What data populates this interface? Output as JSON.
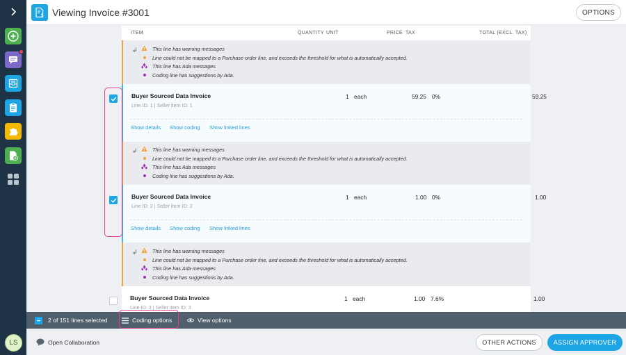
{
  "header": {
    "title": "Viewing Invoice #3001",
    "options_label": "OPTIONS"
  },
  "sidebar": {
    "avatar_initials": "LS",
    "items": [
      {
        "icon": "add-icon",
        "color": "#4caf50"
      },
      {
        "icon": "messages-icon",
        "color": "#7b68c9",
        "badge": true
      },
      {
        "icon": "inbox-icon",
        "color": "#1ea5e6"
      },
      {
        "icon": "clipboard-icon",
        "color": "#1ea5e6"
      },
      {
        "icon": "puzzle-icon",
        "color": "#f5b800"
      },
      {
        "icon": "add-document-icon",
        "color": "#4caf50"
      },
      {
        "icon": "apps-grid-icon",
        "color": "#b9c3cc"
      }
    ]
  },
  "table": {
    "columns": {
      "item": "ITEM",
      "quantity": "QUANTITY",
      "unit": "UNIT",
      "price": "PRICE",
      "tax": "TAX",
      "total": "TOTAL (EXCL. TAX)"
    },
    "messages": {
      "warning_header": "This line has warning messages",
      "warning_detail": "Line could not be mapped to a Purchase order line, and exceeds the threshold for what is automatically accepted.",
      "ada_header": "This line has Ada messages",
      "ada_detail": "Coding line has suggestions by Ada."
    },
    "links": {
      "details": "Show details",
      "coding": "Show coding",
      "linked": "Show linked lines"
    },
    "lines": [
      {
        "name": "Buyer Sourced Data Invoice",
        "meta": "Line ID: 1 | Seller item ID: 1",
        "quantity": "1",
        "unit": "each",
        "price": "59.25",
        "tax": "0%",
        "total": "59.25",
        "selected": true
      },
      {
        "name": "Buyer Sourced Data Invoice",
        "meta": "Line ID: 2 | Seller item ID: 2",
        "quantity": "1",
        "unit": "each",
        "price": "1.00",
        "tax": "0%",
        "total": "1.00",
        "selected": true
      },
      {
        "name": "Buyer Sourced Data Invoice",
        "meta": "Line ID: 3 | Seller item ID: 3",
        "quantity": "1",
        "unit": "each",
        "price": "1.00",
        "tax": "7.6%",
        "total": "1.00",
        "selected": false
      }
    ]
  },
  "selection_bar": {
    "count_label": "2 of 151 lines selected",
    "coding_options": "Coding options",
    "view_options": "View options"
  },
  "footer": {
    "collaboration": "Open Collaboration",
    "other_actions": "OTHER ACTIONS",
    "assign_approver": "ASSIGN APPROVER"
  },
  "colors": {
    "accent": "#1ea5e6",
    "warning": "#f2a23a",
    "ada": "#9b2fb5",
    "highlight": "#e2408d"
  }
}
